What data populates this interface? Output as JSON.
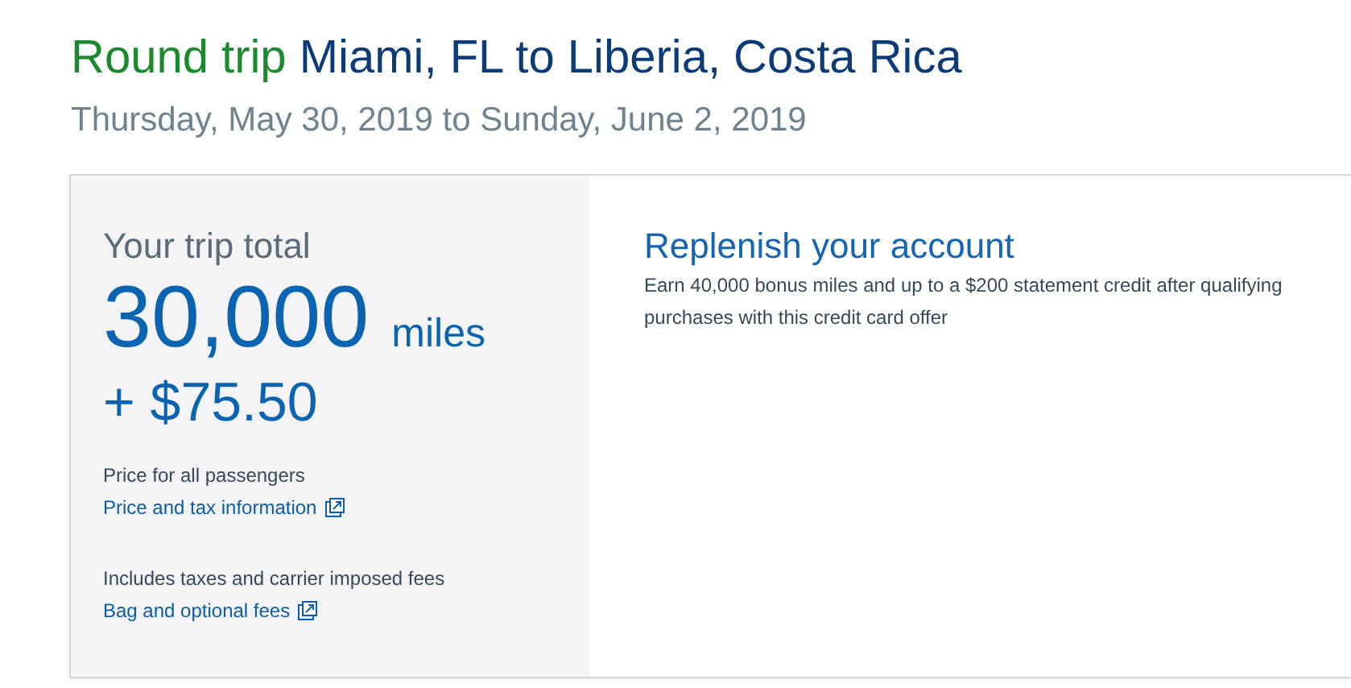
{
  "heading": {
    "prefix": "Round trip",
    "route": "Miami, FL to Liberia, Costa Rica"
  },
  "dates": "Thursday, May 30, 2019 to Sunday, June 2, 2019",
  "total": {
    "label": "Your trip total",
    "amount": "30,000",
    "unit": "miles",
    "extra": "+ $75.50",
    "notes": [
      {
        "kind": "text",
        "text": "Price for all passengers"
      },
      {
        "kind": "link",
        "text": "Price and tax information"
      },
      {
        "kind": "gap"
      },
      {
        "kind": "text",
        "text": "Includes taxes and carrier imposed fees"
      },
      {
        "kind": "link",
        "text": "Bag and optional fees"
      }
    ]
  },
  "offer": {
    "title": "Replenish your account",
    "text": "Earn 40,000 bonus miles and up to a $200 statement credit after qualifying purchases with this credit card offer"
  }
}
